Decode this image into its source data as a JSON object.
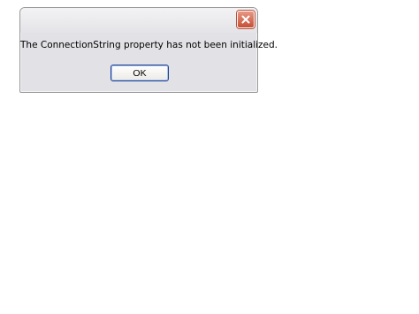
{
  "dialog": {
    "close_icon": "close-icon",
    "message": "The ConnectionString property has not been initialized.",
    "ok_label": "OK"
  },
  "colors": {
    "dialog_background": "#e2e2e6",
    "close_button": "#c55036",
    "ok_border": "#1b3c8d"
  }
}
